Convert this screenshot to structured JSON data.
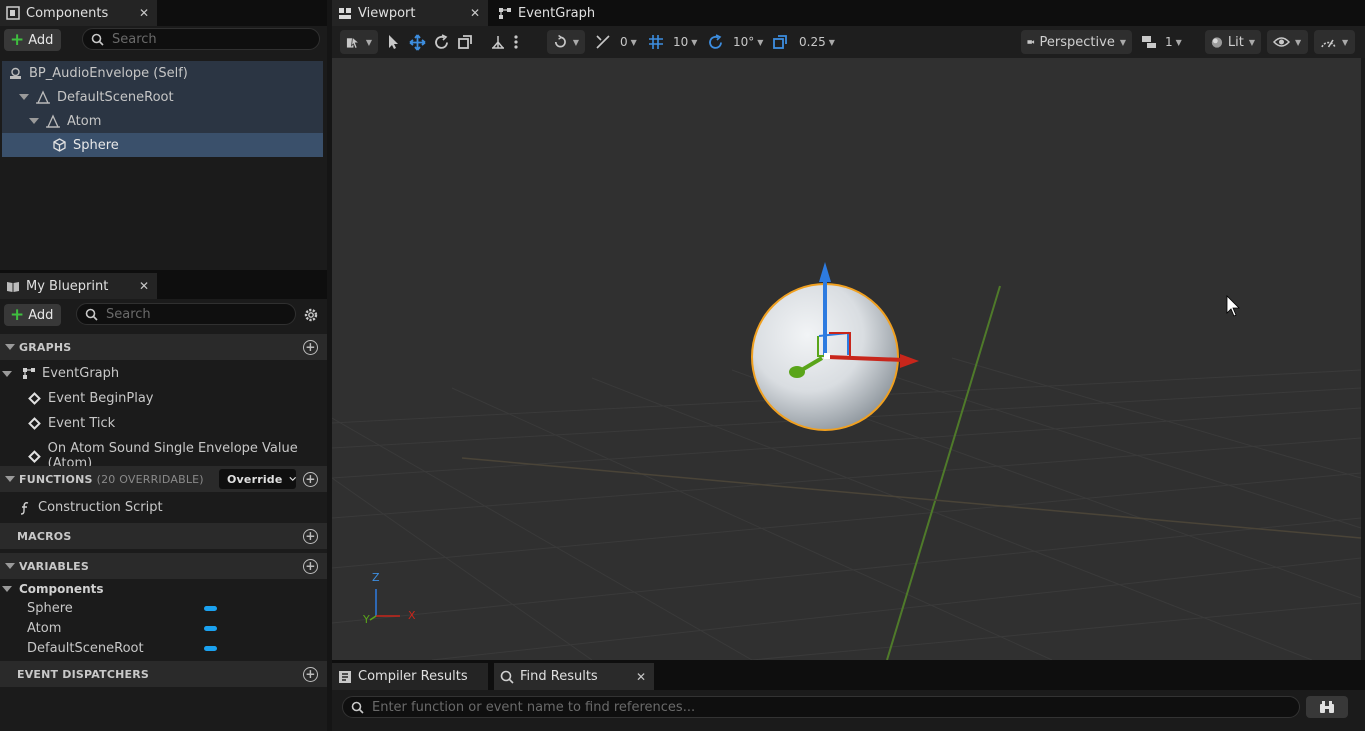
{
  "components_panel": {
    "tab_label": "Components",
    "add_label": "Add",
    "search_placeholder": "Search",
    "tree": [
      {
        "label": "BP_AudioEnvelope (Self)"
      },
      {
        "label": "DefaultSceneRoot"
      },
      {
        "label": "Atom"
      },
      {
        "label": "Sphere"
      }
    ]
  },
  "blueprint_panel": {
    "tab_label": "My Blueprint",
    "add_label": "Add",
    "search_placeholder": "Search",
    "sections": {
      "graphs": "GRAPHS",
      "functions": "FUNCTIONS",
      "functions_count": "(20 OVERRIDABLE)",
      "override_label": "Override",
      "macros": "MACROS",
      "variables": "VARIABLES",
      "event_dispatchers": "EVENT DISPATCHERS"
    },
    "graph_items": {
      "event_graph": "EventGraph",
      "events": [
        "Event BeginPlay",
        "Event Tick",
        "On Atom Sound Single Envelope Value (Atom)"
      ]
    },
    "function_items": [
      "Construction Script"
    ],
    "variable_category": "Components",
    "variables": [
      "Sphere",
      "Atom",
      "DefaultSceneRoot"
    ],
    "variable_color": "#1ba2f0"
  },
  "viewport": {
    "tabs": [
      "Viewport",
      "EventGraph"
    ],
    "toolbar": {
      "translate_snap": "0",
      "grid_snap": "10",
      "rotation_snap": "10°",
      "scale_snap": "0.25",
      "view_mode": "Perspective",
      "viewport_count": "1",
      "lighting": "Lit"
    },
    "axis_labels": {
      "z": "Z",
      "y": "Y",
      "x": "X"
    },
    "colors": {
      "x_axis": "#c8261b",
      "y_axis": "#5aa51a",
      "z_axis": "#2d7be0",
      "selection": "#f0a020"
    }
  },
  "bottom_panel": {
    "tabs": [
      "Compiler Results",
      "Find Results"
    ],
    "find_placeholder": "Enter function or event name to find references..."
  }
}
